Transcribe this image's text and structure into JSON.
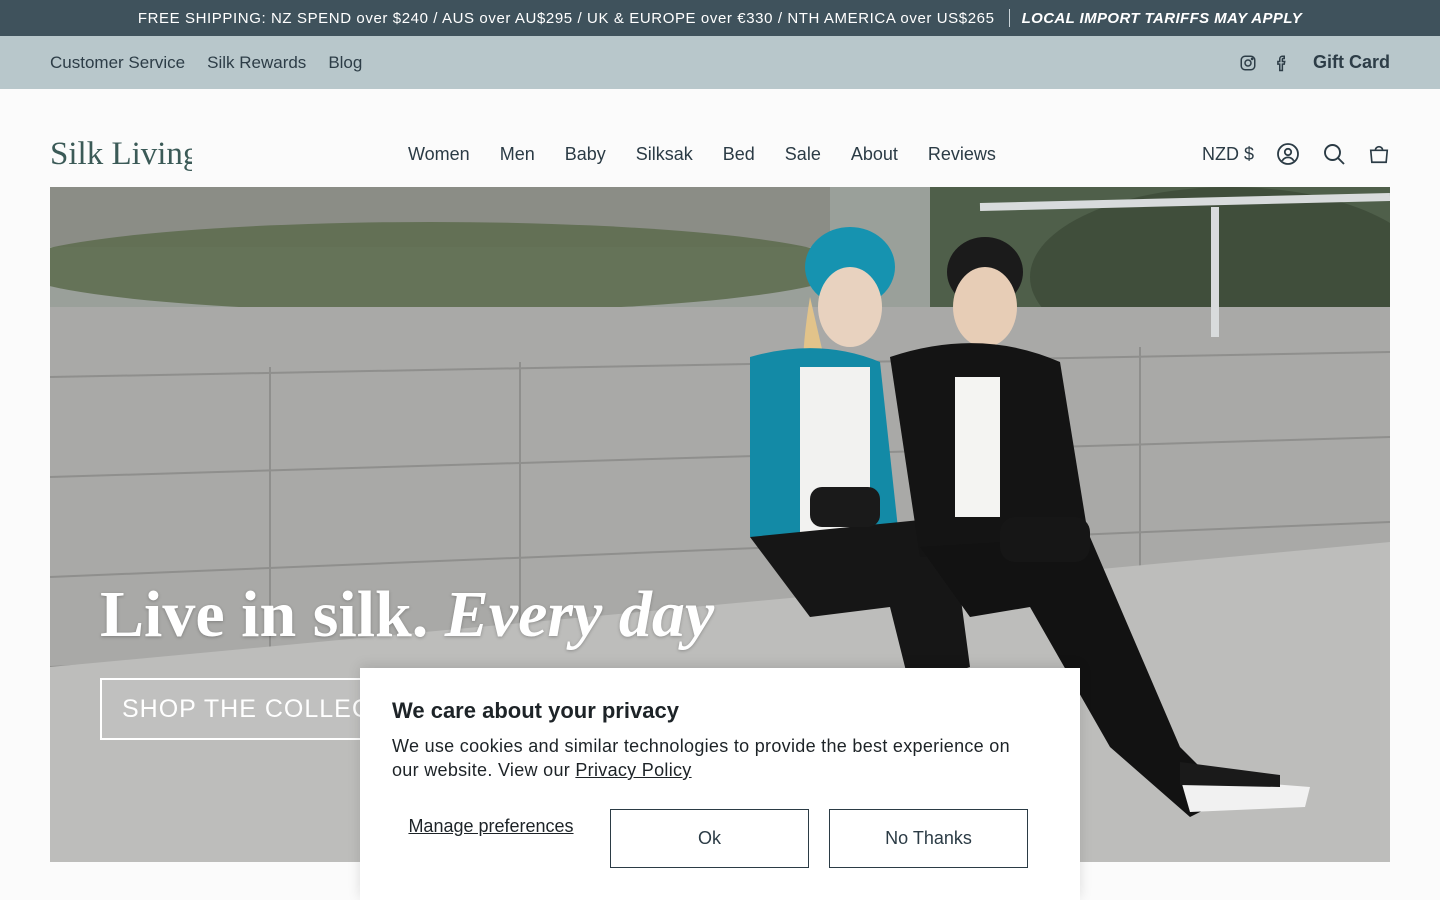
{
  "announcement": {
    "shipping": "FREE SHIPPING: NZ SPEND over $240 / AUS over AU$295 / UK & EUROPE over €330 / NTH AMERICA over US$265",
    "tariff": "LOCAL IMPORT TARIFFS MAY APPLY"
  },
  "utility": {
    "links": [
      "Customer Service",
      "Silk Rewards",
      "Blog"
    ],
    "social": [
      "instagram-icon",
      "facebook-icon"
    ],
    "gift_card": "Gift Card"
  },
  "logo": {
    "text": "Silk Living"
  },
  "nav": [
    "Women",
    "Men",
    "Baby",
    "Silksak",
    "Bed",
    "Sale",
    "About",
    "Reviews"
  ],
  "header_right": {
    "currency": "NZD $",
    "icons": [
      "account-icon",
      "search-icon",
      "cart-icon"
    ]
  },
  "hero": {
    "title_regular": "Live in silk.",
    "title_italic": "Every day",
    "cta": "SHOP THE COLLECTION"
  },
  "cookie": {
    "title": "We care about your privacy",
    "body": "We use cookies and similar technologies to provide the best experience on our website. View our",
    "policy_link": "Privacy Policy",
    "manage": "Manage preferences",
    "ok": "Ok",
    "no_thanks": "No Thanks"
  },
  "colors": {
    "announcement_bg": "#3f525c",
    "utility_bg": "#b8c7cb",
    "logo_green": "#3b5a57"
  }
}
